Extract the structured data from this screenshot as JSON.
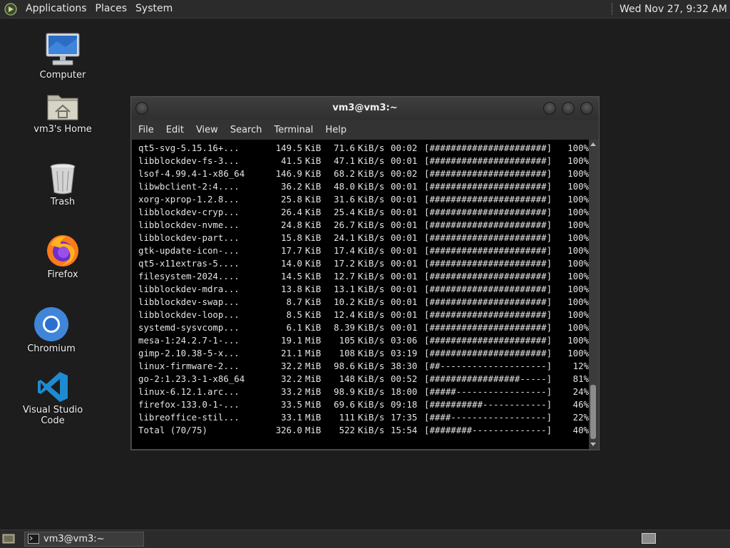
{
  "top_panel": {
    "menus": [
      "Applications",
      "Places",
      "System"
    ],
    "clock": "Wed Nov 27,  9:32 AM"
  },
  "desktop_icons": [
    {
      "label": "Computer",
      "icon": "computer-icon"
    },
    {
      "label": "vm3's Home",
      "icon": "home-folder-icon"
    },
    {
      "label": "Trash",
      "icon": "trash-icon"
    },
    {
      "label": "Firefox",
      "icon": "firefox-icon"
    },
    {
      "label": "Chromium",
      "icon": "chromium-icon"
    },
    {
      "label": "Visual Studio Code",
      "icon": "vscode-icon"
    }
  ],
  "terminal": {
    "title": "vm3@vm3:~",
    "menu": [
      "File",
      "Edit",
      "View",
      "Search",
      "Terminal",
      "Help"
    ],
    "rows": [
      {
        "name": "qt5-svg-5.15.16+...",
        "size": "149.5",
        "unit": "KiB",
        "speed": "71.6",
        "speed_unit": "KiB/s",
        "time": "00:02",
        "bar": "[######################]",
        "pct": "100%"
      },
      {
        "name": "libblockdev-fs-3...",
        "size": "41.5",
        "unit": "KiB",
        "speed": "47.1",
        "speed_unit": "KiB/s",
        "time": "00:01",
        "bar": "[######################]",
        "pct": "100%"
      },
      {
        "name": "lsof-4.99.4-1-x86_64",
        "size": "146.9",
        "unit": "KiB",
        "speed": "68.2",
        "speed_unit": "KiB/s",
        "time": "00:02",
        "bar": "[######################]",
        "pct": "100%"
      },
      {
        "name": "libwbclient-2:4....",
        "size": "36.2",
        "unit": "KiB",
        "speed": "48.0",
        "speed_unit": "KiB/s",
        "time": "00:01",
        "bar": "[######################]",
        "pct": "100%"
      },
      {
        "name": "xorg-xprop-1.2.8...",
        "size": "25.8",
        "unit": "KiB",
        "speed": "31.6",
        "speed_unit": "KiB/s",
        "time": "00:01",
        "bar": "[######################]",
        "pct": "100%"
      },
      {
        "name": "libblockdev-cryp...",
        "size": "26.4",
        "unit": "KiB",
        "speed": "25.4",
        "speed_unit": "KiB/s",
        "time": "00:01",
        "bar": "[######################]",
        "pct": "100%"
      },
      {
        "name": "libblockdev-nvme...",
        "size": "24.8",
        "unit": "KiB",
        "speed": "26.7",
        "speed_unit": "KiB/s",
        "time": "00:01",
        "bar": "[######################]",
        "pct": "100%"
      },
      {
        "name": "libblockdev-part...",
        "size": "15.8",
        "unit": "KiB",
        "speed": "24.1",
        "speed_unit": "KiB/s",
        "time": "00:01",
        "bar": "[######################]",
        "pct": "100%"
      },
      {
        "name": "gtk-update-icon-...",
        "size": "17.7",
        "unit": "KiB",
        "speed": "17.4",
        "speed_unit": "KiB/s",
        "time": "00:01",
        "bar": "[######################]",
        "pct": "100%"
      },
      {
        "name": "qt5-x11extras-5....",
        "size": "14.0",
        "unit": "KiB",
        "speed": "17.2",
        "speed_unit": "KiB/s",
        "time": "00:01",
        "bar": "[######################]",
        "pct": "100%"
      },
      {
        "name": "filesystem-2024....",
        "size": "14.5",
        "unit": "KiB",
        "speed": "12.7",
        "speed_unit": "KiB/s",
        "time": "00:01",
        "bar": "[######################]",
        "pct": "100%"
      },
      {
        "name": "libblockdev-mdra...",
        "size": "13.8",
        "unit": "KiB",
        "speed": "13.1",
        "speed_unit": "KiB/s",
        "time": "00:01",
        "bar": "[######################]",
        "pct": "100%"
      },
      {
        "name": "libblockdev-swap...",
        "size": "8.7",
        "unit": "KiB",
        "speed": "10.2",
        "speed_unit": "KiB/s",
        "time": "00:01",
        "bar": "[######################]",
        "pct": "100%"
      },
      {
        "name": "libblockdev-loop...",
        "size": "8.5",
        "unit": "KiB",
        "speed": "12.4",
        "speed_unit": "KiB/s",
        "time": "00:01",
        "bar": "[######################]",
        "pct": "100%"
      },
      {
        "name": "systemd-sysvcomp...",
        "size": "6.1",
        "unit": "KiB",
        "speed": "8.39",
        "speed_unit": "KiB/s",
        "time": "00:01",
        "bar": "[######################]",
        "pct": "100%"
      },
      {
        "name": "mesa-1:24.2.7-1-...",
        "size": "19.1",
        "unit": "MiB",
        "speed": "105",
        "speed_unit": "KiB/s",
        "time": "03:06",
        "bar": "[######################]",
        "pct": "100%"
      },
      {
        "name": "gimp-2.10.38-5-x...",
        "size": "21.1",
        "unit": "MiB",
        "speed": "108",
        "speed_unit": "KiB/s",
        "time": "03:19",
        "bar": "[######################]",
        "pct": "100%"
      },
      {
        "name": "linux-firmware-2...",
        "size": "32.2",
        "unit": "MiB",
        "speed": "98.6",
        "speed_unit": "KiB/s",
        "time": "38:30",
        "bar": "[##--------------------]",
        "pct": "12%"
      },
      {
        "name": "go-2:1.23.3-1-x86_64",
        "size": "32.2",
        "unit": "MiB",
        "speed": "148",
        "speed_unit": "KiB/s",
        "time": "00:52",
        "bar": "[#################-----]",
        "pct": "81%"
      },
      {
        "name": "linux-6.12.1.arc...",
        "size": "33.2",
        "unit": "MiB",
        "speed": "98.9",
        "speed_unit": "KiB/s",
        "time": "18:00",
        "bar": "[#####-----------------]",
        "pct": "24%"
      },
      {
        "name": "firefox-133.0-1-...",
        "size": "33.5",
        "unit": "MiB",
        "speed": "69.6",
        "speed_unit": "KiB/s",
        "time": "09:18",
        "bar": "[##########------------]",
        "pct": "46%"
      },
      {
        "name": "libreoffice-stil...",
        "size": "33.1",
        "unit": "MiB",
        "speed": "111",
        "speed_unit": "KiB/s",
        "time": "17:35",
        "bar": "[####------------------]",
        "pct": "22%"
      },
      {
        "name": "Total (70/75)",
        "size": "326.0",
        "unit": "MiB",
        "speed": "522",
        "speed_unit": "KiB/s",
        "time": "15:54",
        "bar": "[########--------------]",
        "pct": "40%"
      }
    ]
  },
  "bottom_panel": {
    "tasks": [
      {
        "label": "vm3@vm3:~"
      }
    ]
  }
}
